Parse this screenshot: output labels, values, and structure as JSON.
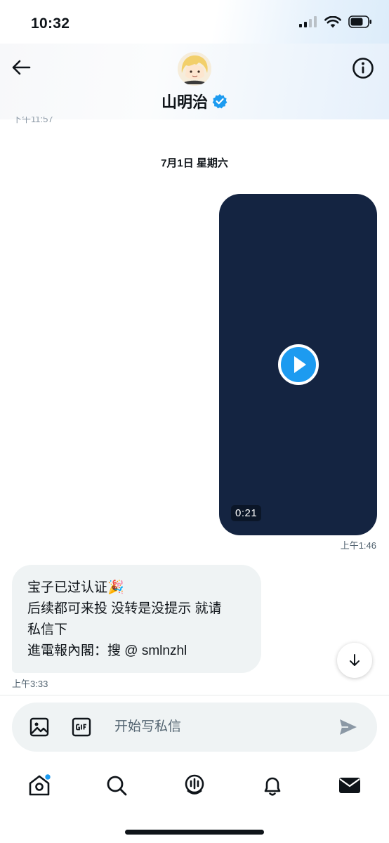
{
  "status_bar": {
    "time": "10:32"
  },
  "header": {
    "contact_name": "山明治",
    "verified_icon": "verified-badge-icon",
    "previous_time_partial": "下午11:57"
  },
  "conversation": {
    "date_separator": "7月1日 星期六",
    "video_message": {
      "duration": "0:21",
      "time": "上午1:46"
    },
    "text_message": {
      "lines": [
        "宝子已过认证🎉",
        "后续都可来投 没转是没提示 就请",
        "私信下",
        "進電報內閣：搜 @ smlnzhl"
      ],
      "time": "上午3:33"
    }
  },
  "composer": {
    "placeholder": "开始写私信"
  },
  "colors": {
    "accent": "#1d9bf0",
    "video_bg": "#142441",
    "bubble_bg": "#eff3f4"
  },
  "tab_bar": {
    "tabs": [
      "home-icon",
      "search-icon",
      "spaces-icon",
      "notifications-icon",
      "messages-icon"
    ]
  }
}
